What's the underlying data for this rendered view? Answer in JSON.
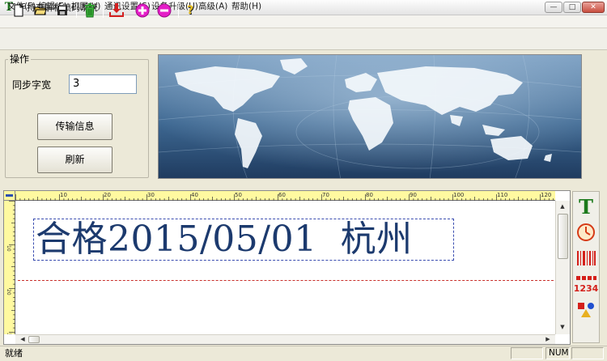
{
  "window": {
    "title": "手持高解析喷码系统",
    "app_icon_glyph": "T",
    "minimize_glyph": "—",
    "maximize_glyph": "□",
    "close_glyph": "✕"
  },
  "menu": {
    "items": [
      "文件(F)",
      "编辑(E)",
      "视图(V)",
      "通讯设置(S)",
      "设备升级(U)",
      "高级(A)",
      "帮助(H)"
    ]
  },
  "toolbar": {
    "buttons": [
      "new-file-icon",
      "open-folder-icon",
      "save-icon",
      "delete-trash-icon",
      "download-icon",
      "zoom-in-icon",
      "zoom-out-icon",
      "help-icon"
    ]
  },
  "operation": {
    "group_title": "操作",
    "sync_width_label": "同步字宽",
    "sync_width_value": "3",
    "transmit_button": "传输信息",
    "refresh_button": "刷新"
  },
  "ruler": {
    "top_labels": [
      "10",
      "20",
      "30",
      "40",
      "50",
      "60",
      "70",
      "80",
      "90",
      "100",
      "110",
      "120"
    ],
    "left_labels": [
      "10",
      "20",
      "30"
    ]
  },
  "editor": {
    "print_text": "合格2015/05/01  杭州"
  },
  "side_tools": {
    "text_glyph": "T",
    "counter_glyph": "1234"
  },
  "status": {
    "ready": "就绪",
    "num": "NUM"
  },
  "colors": {
    "print_text": "#1c3a6e",
    "ruler_yellow": "#fff9a0",
    "guide_red": "#c9302c",
    "selection_blue": "#3a4db0"
  }
}
